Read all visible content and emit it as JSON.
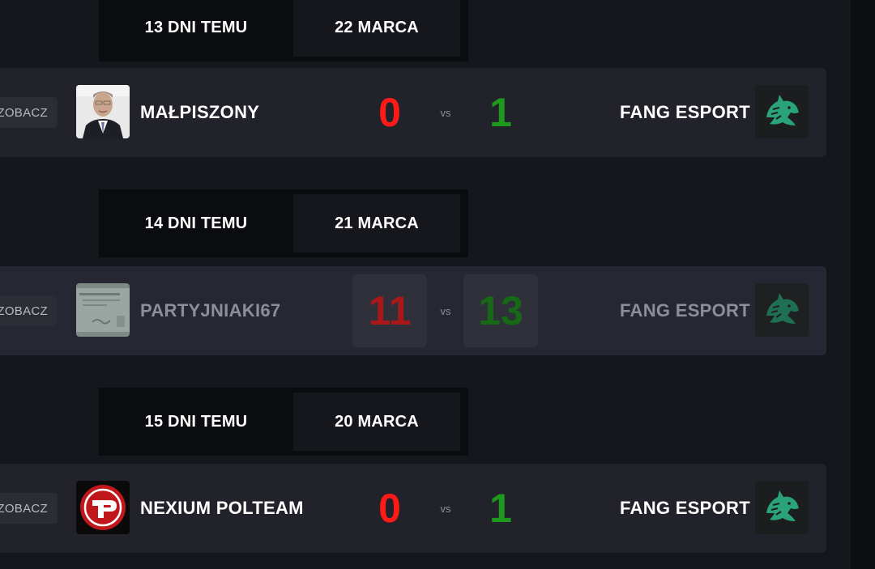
{
  "see_label": "ZOBACZ",
  "vs_label": "vs",
  "groups": [
    {
      "ago": "13 DNI TEMU",
      "date": "22 MARCA",
      "home_team": "MAŁPISZONY",
      "home_score": "0",
      "away_team": "FANG ESPORT",
      "away_score": "1",
      "home_logo": "portrait-photo-logo",
      "away_logo": "green-wolf-logo"
    },
    {
      "ago": "14 DNI TEMU",
      "date": "21 MARCA",
      "home_team": "PARTYJNIAKI67",
      "home_score": "11",
      "away_team": "FANG ESPORT",
      "away_score": "13",
      "home_logo": "document-card-logo",
      "away_logo": "green-wolf-logo"
    },
    {
      "ago": "15 DNI TEMU",
      "date": "20 MARCA",
      "home_team": "NEXIUM POLTEAM",
      "home_score": "0",
      "away_team": "FANG ESPORT",
      "away_score": "1",
      "home_logo": "red-circle-p-logo",
      "away_logo": "green-wolf-logo"
    }
  ],
  "colors": {
    "loss": "#ff1a1a",
    "win": "#1d9a1d",
    "row": "#21222a",
    "row_hover": "#262732"
  }
}
